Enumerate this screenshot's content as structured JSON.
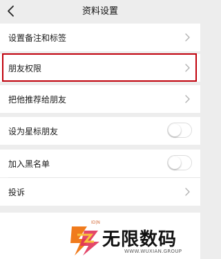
{
  "header": {
    "title": "资料设置"
  },
  "rows": {
    "remark": {
      "label": "设置备注和标签"
    },
    "permissions": {
      "label": "朋友权限"
    },
    "recommend": {
      "label": "把他推荐给朋友"
    },
    "star": {
      "label": "设为星标朋友",
      "on": false
    },
    "blacklist": {
      "label": "加入黑名单",
      "on": false
    },
    "complain": {
      "label": "投诉"
    }
  },
  "watermark": {
    "brand": "无限数码",
    "site": "WWW.WUXIAN.GROUP",
    "small_top": "ID|N"
  },
  "colors": {
    "highlight": "#c0000b",
    "background": "#ededed"
  }
}
